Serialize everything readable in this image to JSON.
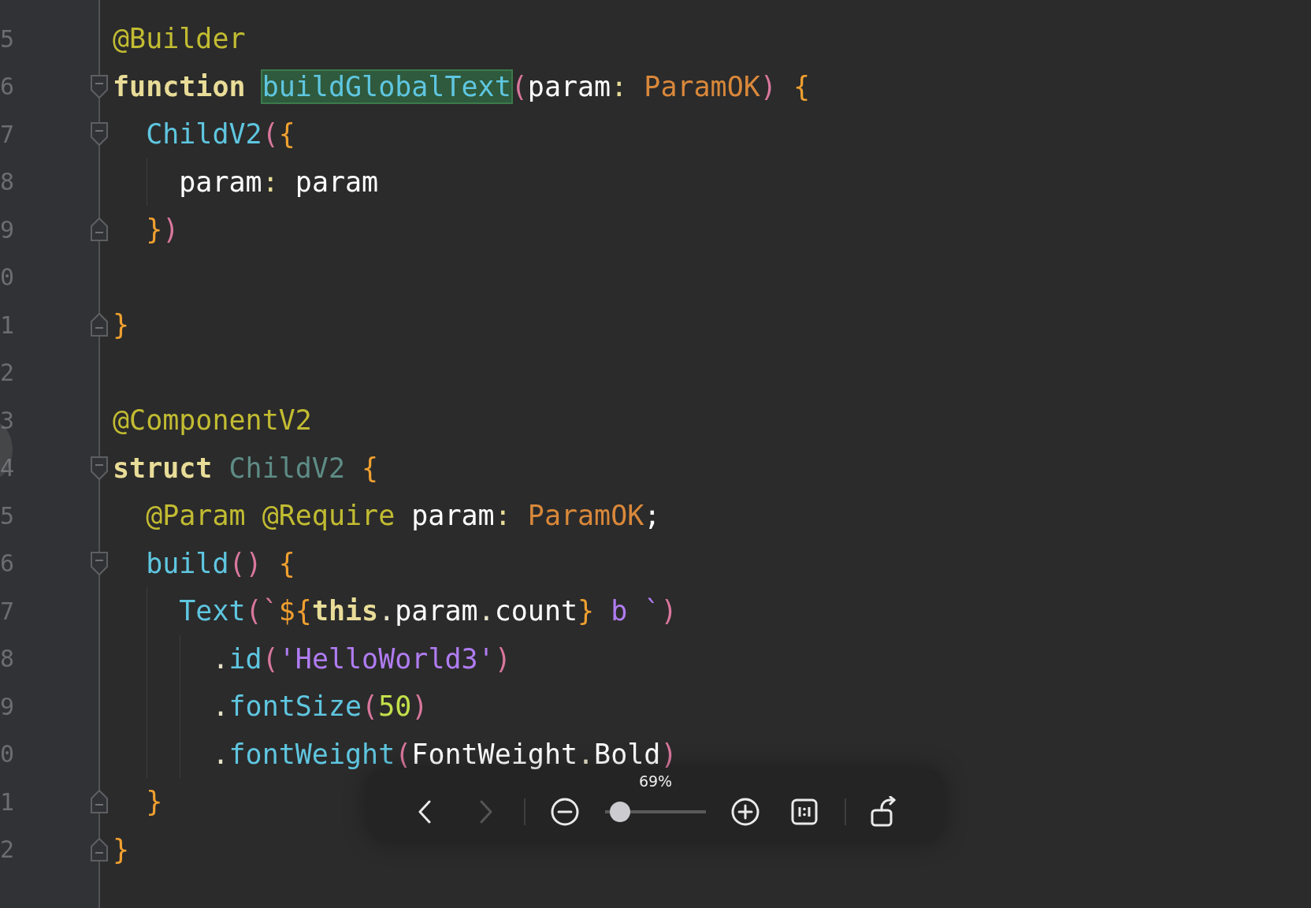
{
  "lines": [
    {
      "number": "5",
      "fold_start": false,
      "fold_end": false,
      "tokens": [
        {
          "text": "@Builder",
          "kind": "annotation"
        }
      ]
    },
    {
      "number": "6",
      "fold_start": true,
      "fold_end": false,
      "tokens": [
        {
          "text": "function ",
          "kind": "keyword"
        },
        {
          "text": "buildGlobalText",
          "kind": "fn",
          "highlighted": true
        },
        {
          "text": "(",
          "kind": "paren"
        },
        {
          "text": "param",
          "kind": "ident"
        },
        {
          "text": ": ",
          "kind": "colon"
        },
        {
          "text": "ParamOK",
          "kind": "type"
        },
        {
          "text": ") ",
          "kind": "paren"
        },
        {
          "text": "{",
          "kind": "brace"
        }
      ]
    },
    {
      "number": "7",
      "fold_start": true,
      "fold_end": false,
      "tokens": [
        {
          "text": "  ChildV2",
          "kind": "fn"
        },
        {
          "text": "(",
          "kind": "paren"
        },
        {
          "text": "{",
          "kind": "brace"
        }
      ]
    },
    {
      "number": "8",
      "fold_start": false,
      "fold_end": false,
      "tokens": [
        {
          "text": "    param",
          "kind": "ident"
        },
        {
          "text": ": ",
          "kind": "colon"
        },
        {
          "text": "param",
          "kind": "ident"
        }
      ]
    },
    {
      "number": "9",
      "fold_start": false,
      "fold_end": true,
      "tokens": [
        {
          "text": "  }",
          "kind": "brace"
        },
        {
          "text": ")",
          "kind": "paren"
        }
      ]
    },
    {
      "number": "0",
      "fold_start": false,
      "fold_end": false
    },
    {
      "number": "1",
      "fold_start": false,
      "fold_end": true,
      "tokens": [
        {
          "text": "}",
          "kind": "brace"
        }
      ]
    },
    {
      "number": "2",
      "fold_start": false,
      "fold_end": false
    },
    {
      "number": "3",
      "fold_start": false,
      "fold_end": false,
      "tokens": [
        {
          "text": "@ComponentV2",
          "kind": "annotation"
        }
      ]
    },
    {
      "number": "4",
      "fold_start": true,
      "fold_end": false,
      "tokens": [
        {
          "text": "struct ",
          "kind": "keyword"
        },
        {
          "text": "ChildV2 ",
          "kind": "decl"
        },
        {
          "text": "{",
          "kind": "brace"
        }
      ]
    },
    {
      "number": "5",
      "fold_start": false,
      "fold_end": false,
      "tokens": [
        {
          "text": "  @Param @Require ",
          "kind": "annotation"
        },
        {
          "text": "param",
          "kind": "ident"
        },
        {
          "text": ": ",
          "kind": "colon"
        },
        {
          "text": "ParamOK",
          "kind": "type"
        },
        {
          "text": ";",
          "kind": "ident"
        }
      ]
    },
    {
      "number": "6",
      "fold_start": true,
      "fold_end": false,
      "tokens": [
        {
          "text": "  build",
          "kind": "fn"
        },
        {
          "text": "() ",
          "kind": "paren"
        },
        {
          "text": "{",
          "kind": "brace"
        }
      ]
    },
    {
      "number": "7",
      "fold_start": false,
      "fold_end": false,
      "tokens": [
        {
          "text": "    Text",
          "kind": "fn"
        },
        {
          "text": "(`",
          "kind": "paren"
        },
        {
          "text": "${",
          "kind": "brace"
        },
        {
          "text": "this",
          "kind": "keyword"
        },
        {
          "text": ".",
          "kind": "dot"
        },
        {
          "text": "param",
          "kind": "ident"
        },
        {
          "text": ".",
          "kind": "dot"
        },
        {
          "text": "count",
          "kind": "ident"
        },
        {
          "text": "}",
          "kind": "brace"
        },
        {
          "text": " b `",
          "kind": "string"
        },
        {
          "text": ")",
          "kind": "paren"
        }
      ]
    },
    {
      "number": "8",
      "fold_start": false,
      "fold_end": false,
      "tokens": [
        {
          "text": "      .",
          "kind": "dot"
        },
        {
          "text": "id",
          "kind": "fn"
        },
        {
          "text": "(",
          "kind": "paren"
        },
        {
          "text": "'HelloWorld3'",
          "kind": "string"
        },
        {
          "text": ")",
          "kind": "paren"
        }
      ]
    },
    {
      "number": "9",
      "fold_start": false,
      "fold_end": false,
      "tokens": [
        {
          "text": "      .",
          "kind": "dot"
        },
        {
          "text": "fontSize",
          "kind": "fn"
        },
        {
          "text": "(",
          "kind": "paren"
        },
        {
          "text": "50",
          "kind": "number"
        },
        {
          "text": ")",
          "kind": "paren"
        }
      ]
    },
    {
      "number": "0",
      "fold_start": false,
      "fold_end": false,
      "tokens": [
        {
          "text": "      .",
          "kind": "dot"
        },
        {
          "text": "fontWeight",
          "kind": "fn"
        },
        {
          "text": "(",
          "kind": "paren"
        },
        {
          "text": "FontWeight",
          "kind": "ident"
        },
        {
          "text": ".",
          "kind": "dot"
        },
        {
          "text": "Bold",
          "kind": "ident"
        },
        {
          "text": ")",
          "kind": "paren"
        }
      ]
    },
    {
      "number": "1",
      "fold_start": false,
      "fold_end": true,
      "tokens": [
        {
          "text": "  }",
          "kind": "brace"
        }
      ]
    },
    {
      "number": "2",
      "fold_start": false,
      "fold_end": true,
      "tokens": [
        {
          "text": "}",
          "kind": "brace"
        }
      ]
    }
  ],
  "toolbar": {
    "back": {
      "disabled": false
    },
    "forward": {
      "disabled": true
    },
    "zoom_label": "69%",
    "zoom": {
      "level": 0.15
    }
  }
}
